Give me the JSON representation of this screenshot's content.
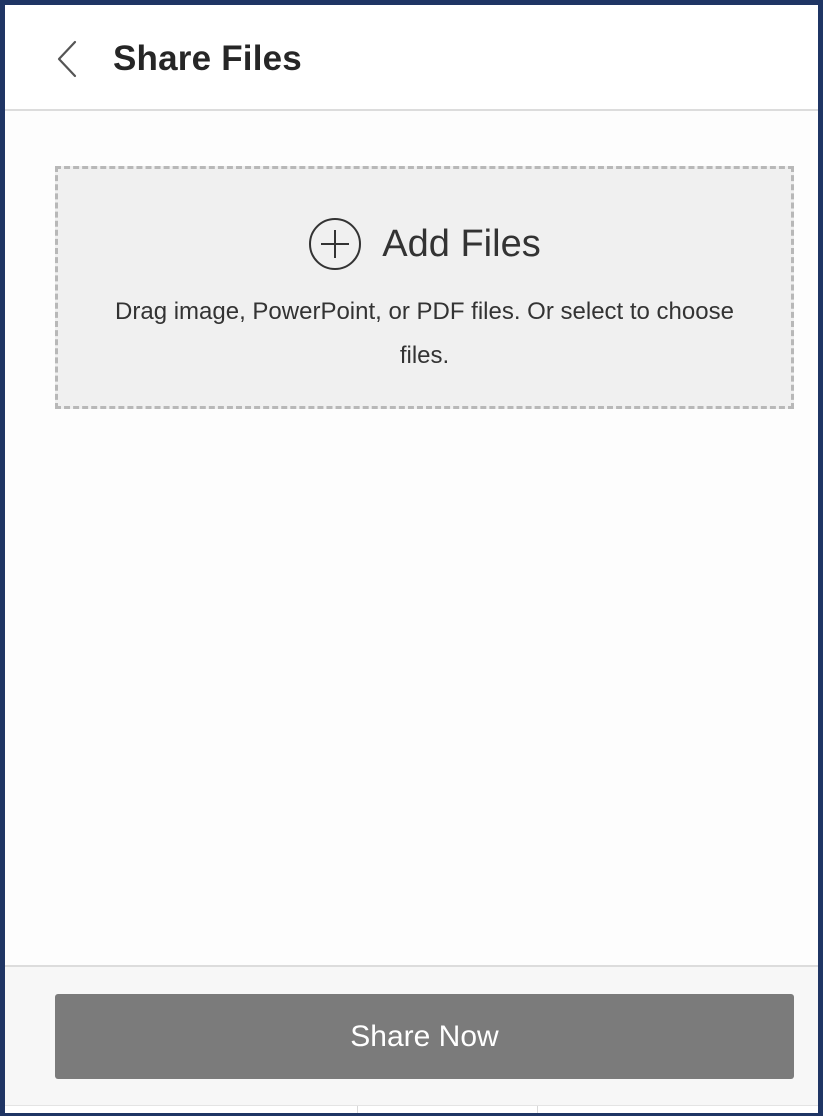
{
  "header": {
    "back_icon": "chevron-left-icon",
    "title": "Share Files"
  },
  "dropzone": {
    "add_icon": "plus-circle-icon",
    "add_label": "Add Files",
    "description": "Drag image, PowerPoint, or PDF files. Or select to choose files."
  },
  "footer": {
    "share_label": "Share Now"
  },
  "colors": {
    "frame_border": "#1f3564",
    "dropzone_bg": "#f0f0f0",
    "dropzone_border": "#b8b8b8",
    "button_bg": "#7b7b7b",
    "button_text": "#ffffff"
  }
}
